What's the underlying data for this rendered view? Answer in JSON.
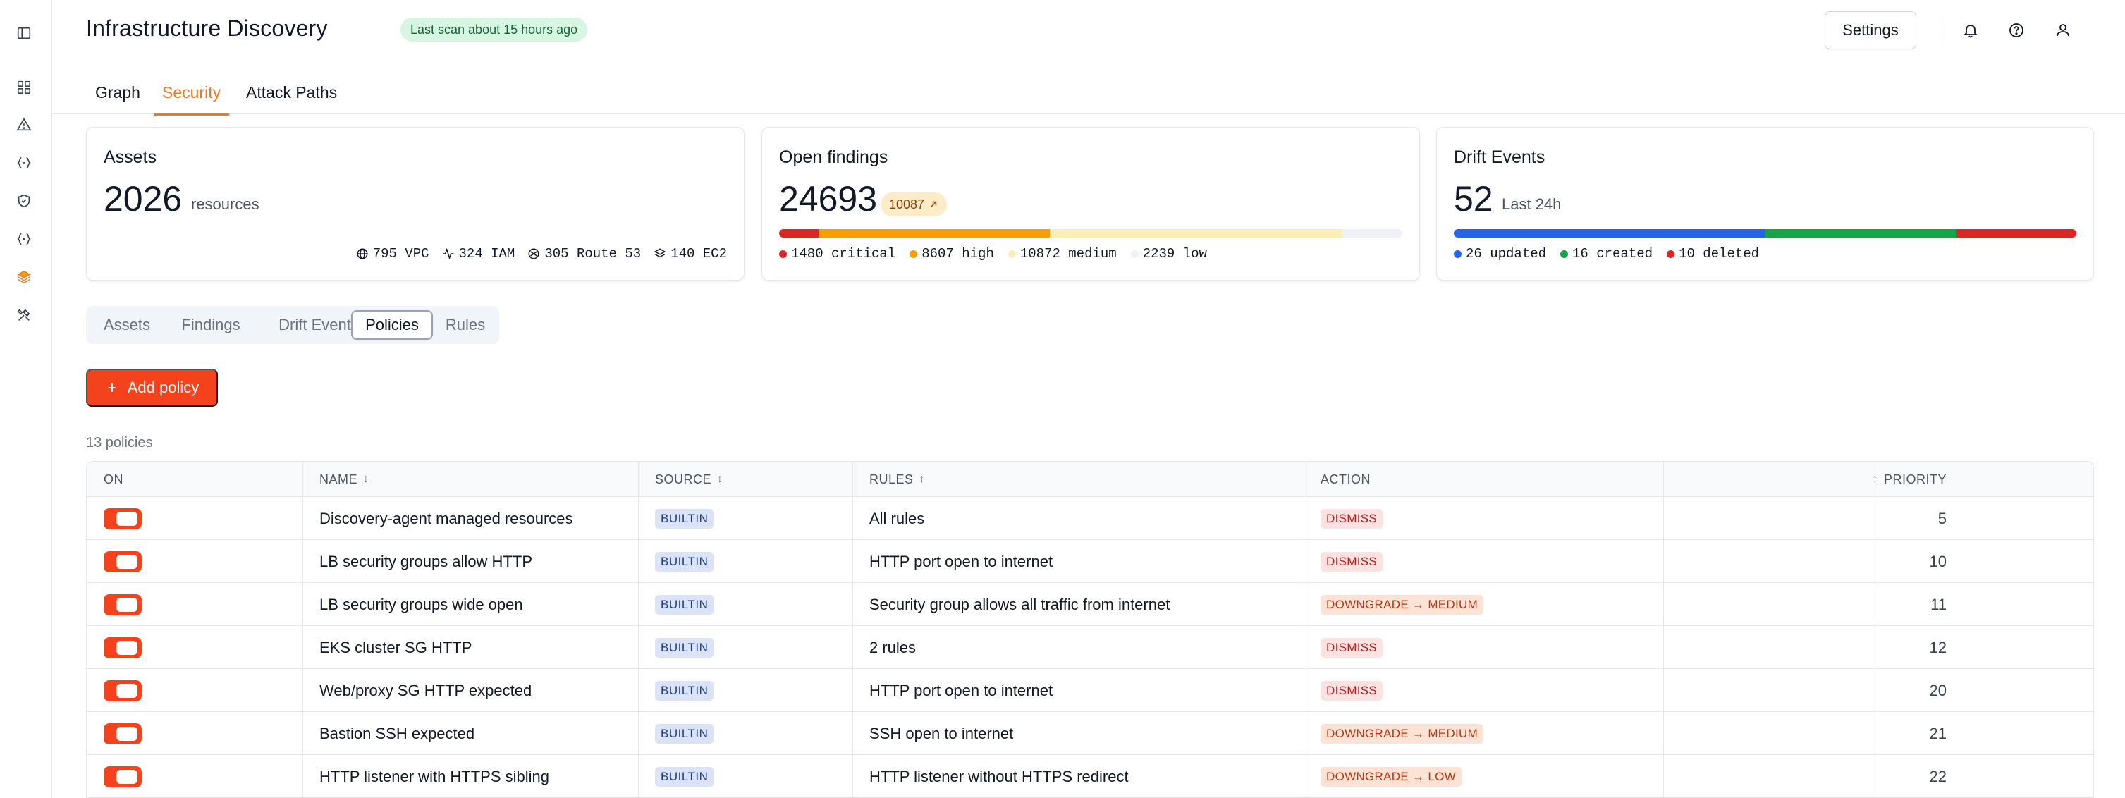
{
  "header": {
    "title": "Infrastructure Discovery",
    "scan_badge": "Last scan about 15 hours ago",
    "settings_label": "Settings"
  },
  "main_tabs": [
    {
      "label": "Graph",
      "active": false
    },
    {
      "label": "Security",
      "active": true
    },
    {
      "label": "Attack Paths",
      "active": false
    }
  ],
  "cards": {
    "assets": {
      "title": "Assets",
      "count": "2026",
      "unit": "resources",
      "breakdown": [
        {
          "icon": "globe-icon",
          "text": "795 VPC"
        },
        {
          "icon": "activity-icon",
          "text": "324 IAM"
        },
        {
          "icon": "route-icon",
          "text": "305 Route 53"
        },
        {
          "icon": "layers-icon",
          "text": "140 EC2"
        }
      ]
    },
    "findings": {
      "title": "Open findings",
      "count": "24693",
      "delta": "10087",
      "severity": [
        {
          "label": "1480 critical",
          "value": 1480,
          "color": "#dc2626"
        },
        {
          "label": "8607 high",
          "value": 8607,
          "color": "#f59e0b"
        },
        {
          "label": "10872 medium",
          "value": 10872,
          "color": "#fdeeb8"
        },
        {
          "label": "2239 low",
          "value": 2239,
          "color": "#eef2f7"
        }
      ]
    },
    "drift": {
      "title": "Drift Events",
      "count": "52",
      "period": "Last 24h",
      "events": [
        {
          "label": "26 updated",
          "value": 26,
          "color": "#2563eb"
        },
        {
          "label": "16 created",
          "value": 16,
          "color": "#16a34a"
        },
        {
          "label": "10 deleted",
          "value": 10,
          "color": "#dc2626"
        }
      ]
    }
  },
  "subtabs": [
    {
      "label": "Assets",
      "active": false
    },
    {
      "label": "Findings",
      "active": false
    },
    {
      "label": "Drift Events",
      "active": false
    },
    {
      "label": "Policies",
      "active": true
    },
    {
      "label": "Rules",
      "active": false
    }
  ],
  "add_policy_label": "Add policy",
  "policy_count": "13 policies",
  "table": {
    "headers": {
      "on": "ON",
      "name": "NAME",
      "source": "SOURCE",
      "rules": "RULES",
      "action": "ACTION",
      "priority": "PRIORITY"
    },
    "rows": [
      {
        "on": true,
        "name": "Discovery-agent managed resources",
        "source": "BUILTIN",
        "rules": "All rules",
        "action": "DISMISS",
        "priority": "5"
      },
      {
        "on": true,
        "name": "LB security groups allow HTTP",
        "source": "BUILTIN",
        "rules": "HTTP port open to internet",
        "action": "DISMISS",
        "priority": "10"
      },
      {
        "on": true,
        "name": "LB security groups wide open",
        "source": "BUILTIN",
        "rules": "Security group allows all traffic from internet",
        "action": "DOWNGRADE → MEDIUM",
        "priority": "11"
      },
      {
        "on": true,
        "name": "EKS cluster SG HTTP",
        "source": "BUILTIN",
        "rules": "2 rules",
        "action": "DISMISS",
        "priority": "12"
      },
      {
        "on": true,
        "name": "Web/proxy SG HTTP expected",
        "source": "BUILTIN",
        "rules": "HTTP port open to internet",
        "action": "DISMISS",
        "priority": "20"
      },
      {
        "on": true,
        "name": "Bastion SSH expected",
        "source": "BUILTIN",
        "rules": "SSH open to internet",
        "action": "DOWNGRADE → MEDIUM",
        "priority": "21"
      },
      {
        "on": true,
        "name": "HTTP listener with HTTPS sibling",
        "source": "BUILTIN",
        "rules": "HTTP listener without HTTPS redirect",
        "action": "DOWNGRADE → LOW",
        "priority": "22"
      }
    ]
  }
}
